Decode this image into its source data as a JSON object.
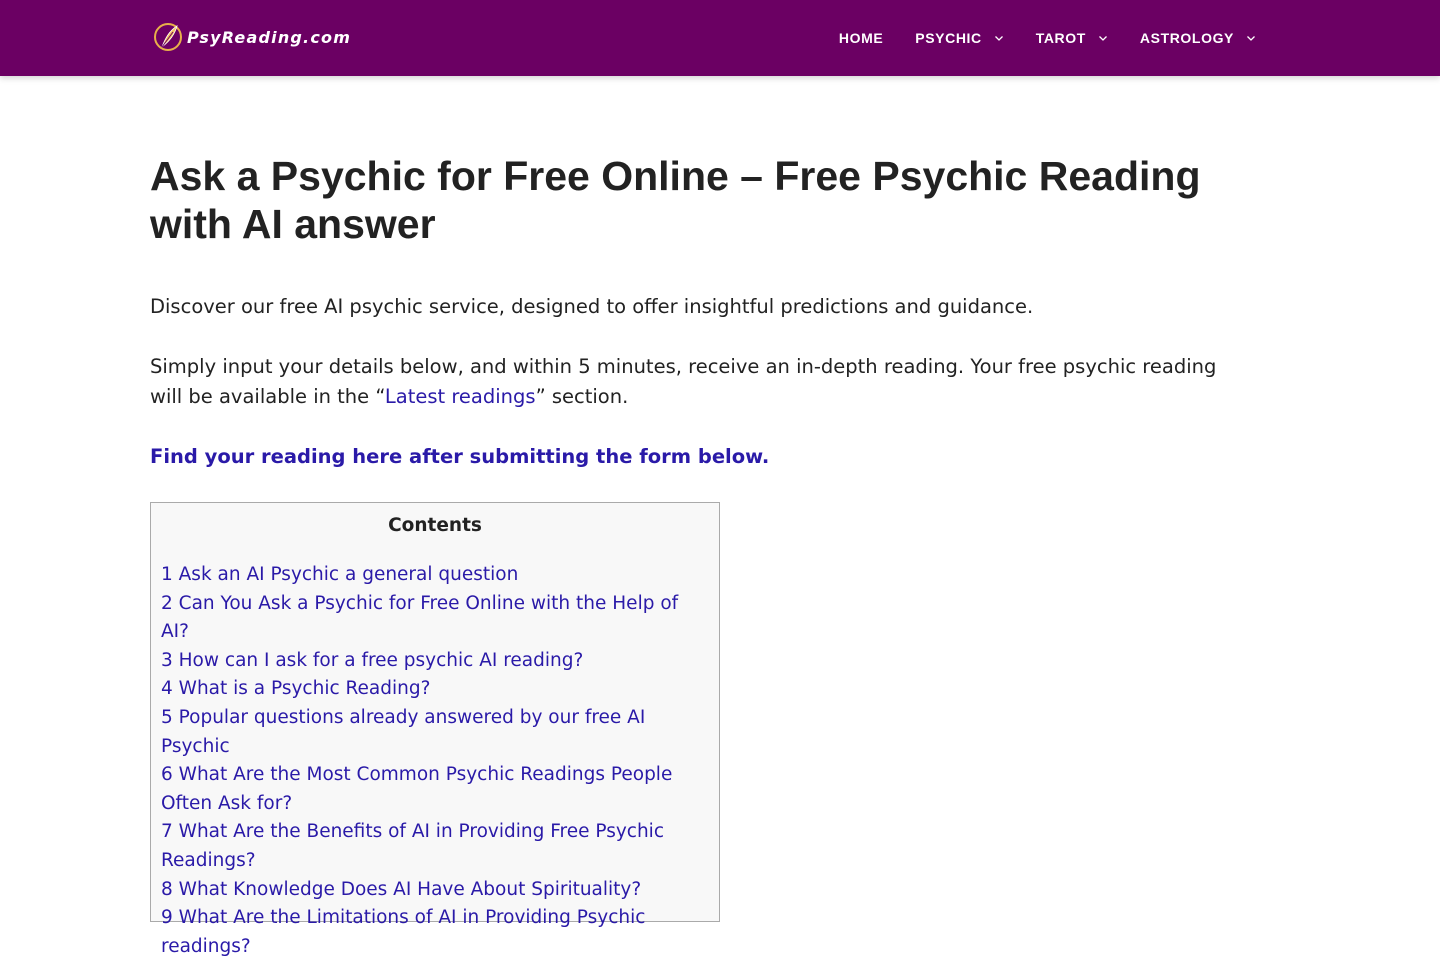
{
  "header": {
    "logo_text": "PsyReading.com",
    "nav": [
      {
        "label": "HOME",
        "has_dropdown": false
      },
      {
        "label": "PSYCHIC",
        "has_dropdown": true
      },
      {
        "label": "TAROT",
        "has_dropdown": true
      },
      {
        "label": "ASTROLOGY",
        "has_dropdown": true
      }
    ]
  },
  "colors": {
    "header_bg": "#6b0063",
    "link": "#2a1aa8",
    "toc_bg": "#f8f8f8"
  },
  "article": {
    "title": "Ask a Psychic for Free Online – Free Psychic Reading with AI answer",
    "intro": "Discover our free AI psychic service, designed to offer insightful predictions and guidance.",
    "instructions_before": "Simply input your details below, and within 5 minutes, receive an in-depth reading. Your free psychic reading will be available in the “",
    "latest_link": "Latest readings",
    "instructions_after": "” section.",
    "find_reading_link": "Find your reading here after submitting the form below."
  },
  "toc": {
    "title": "Contents",
    "items": [
      "1 Ask an AI Psychic a general question",
      "2 Can You Ask a Psychic for Free Online with the Help of AI?",
      "3 How can I ask for a free psychic AI reading?",
      "4 What is a Psychic Reading?",
      "5 Popular questions already answered by our free AI Psychic",
      "6 What Are the Most Common Psychic Readings People Often Ask for?",
      "7 What Are the Benefits of AI in Providing Free Psychic Readings?",
      "8 What Knowledge Does AI Have About Spirituality?",
      "9 What Are the Limitations of AI in Providing Psychic readings?"
    ]
  }
}
